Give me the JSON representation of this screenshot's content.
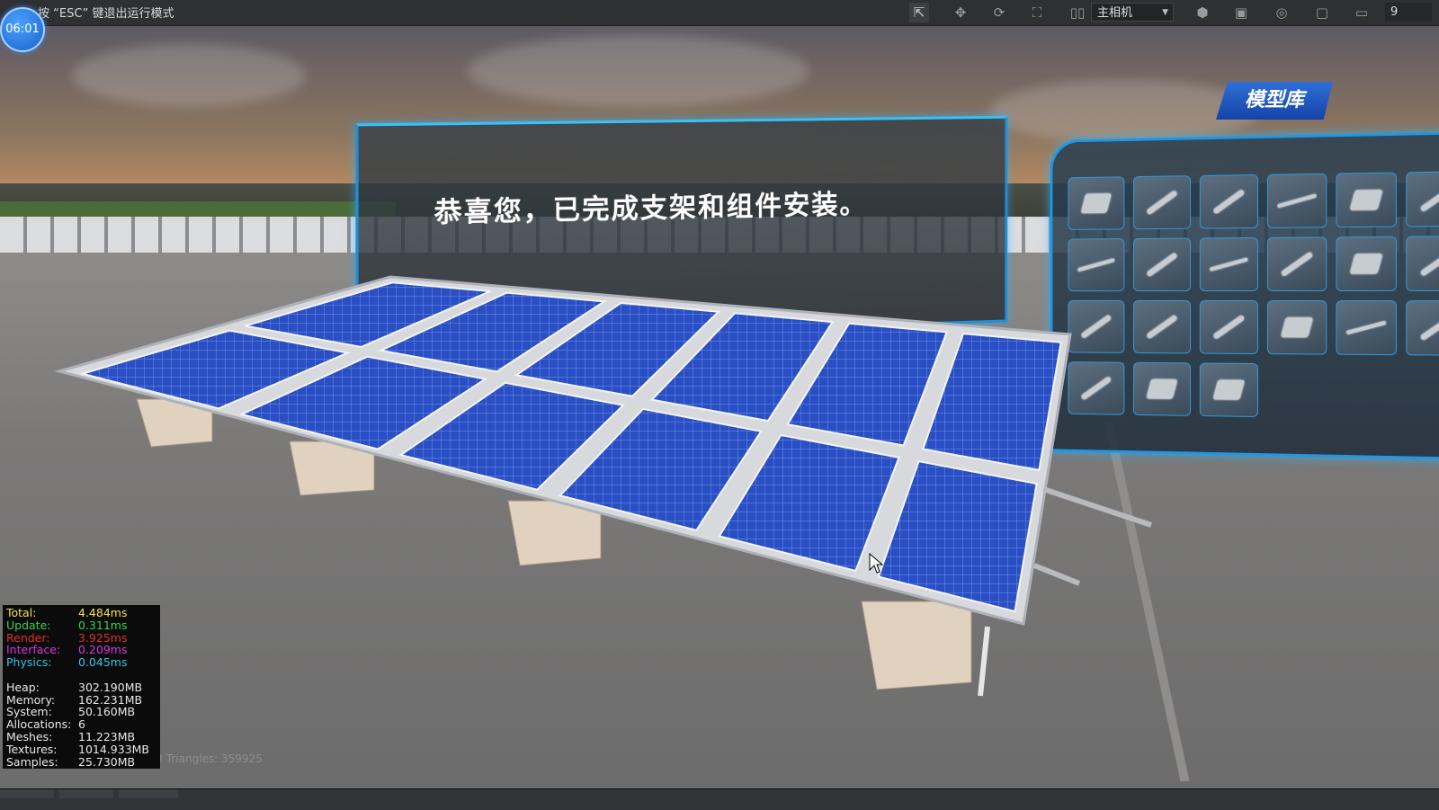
{
  "toolbar": {
    "esc_hint": "按 “ESC” 键退出运行模式",
    "camera_select": "主相机",
    "number_field": "9"
  },
  "timer": {
    "value": "06:01"
  },
  "scene": {
    "message": "恭喜您，已完成支架和组件安装。",
    "model_library_title": "模型库",
    "model_library_items": [
      "bracket-part-icon",
      "washer-part-icon",
      "rail-part-icon",
      "bolt-part-icon",
      "base-plate-icon",
      "partial-part-icon",
      "screw-part-icon",
      "rail-part-icon",
      "threaded-rod-icon",
      "rail-part-icon",
      "triangle-bracket-icon",
      "partial-part-icon",
      "rail-part-icon",
      "anchor-part-icon",
      "panel-part-icon",
      "angle-bracket-icon",
      "bolt-part-icon",
      "partial-part-icon",
      "partial-part-icon",
      "clamp-part-icon",
      "clamp-part-icon"
    ]
  },
  "stats": {
    "rows": [
      {
        "label": "Total:",
        "value": "4.484ms",
        "color": "#f3e24b"
      },
      {
        "label": "Update:",
        "value": "0.311ms",
        "color": "#38d24a"
      },
      {
        "label": "Render:",
        "value": "3.925ms",
        "color": "#e0302c"
      },
      {
        "label": "Interface:",
        "value": "0.209ms",
        "color": "#d23ad8"
      },
      {
        "label": "Physics:",
        "value": "0.045ms",
        "color": "#34c3e8"
      }
    ],
    "memory": [
      {
        "label": "Heap:",
        "value": "302.190MB"
      },
      {
        "label": "Memory:",
        "value": "162.231MB"
      },
      {
        "label": "System:",
        "value": "50.160MB"
      },
      {
        "label": "Allocations:",
        "value": "6"
      },
      {
        "label": "Meshes:",
        "value": "11.223MB"
      },
      {
        "label": "Textures:",
        "value": "1014.933MB"
      },
      {
        "label": "Samples:",
        "value": "25.730MB"
      }
    ],
    "bottom_info": "No...   Meshes: 1713   Triangles: 359925"
  },
  "colors": {
    "accent_blue": "#1e8fd8",
    "panel_blue": "#2d5fd6",
    "toolbar_bg": "#2f3033"
  }
}
